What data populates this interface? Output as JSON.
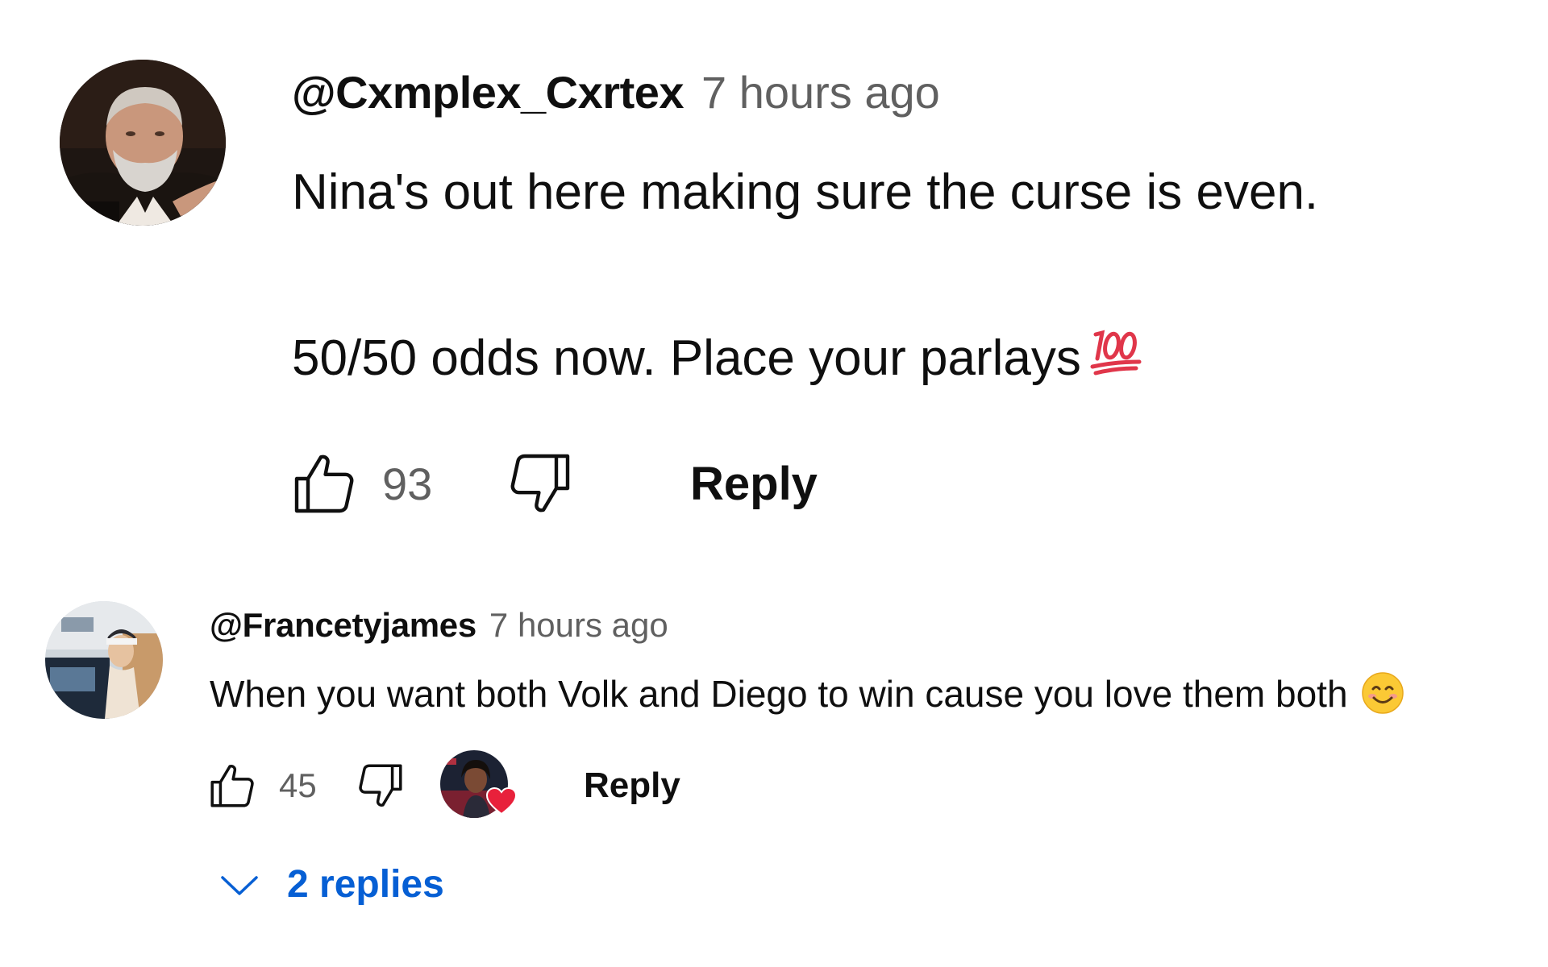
{
  "comments": [
    {
      "author": "@Cxmplex_Cxrtex",
      "time": "7 hours ago",
      "text_line1": "Nina's out here making sure the curse is even.",
      "text_line2": "50/50 odds now. Place your parlays",
      "emoji": "hundred-points-emoji",
      "likes": "93",
      "reply_label": "Reply"
    },
    {
      "author": "@Francetyjames",
      "time": "7 hours ago",
      "text": "When you want both Volk and Diego to win cause you love them both",
      "emoji": "smiling-face-emoji",
      "likes": "45",
      "creator_hearted": true,
      "reply_label": "Reply",
      "replies_label": "2 replies"
    }
  ],
  "colors": {
    "text": "#0f0f0f",
    "secondary": "#606060",
    "link": "#065fd4",
    "heart": "#e8213b"
  }
}
